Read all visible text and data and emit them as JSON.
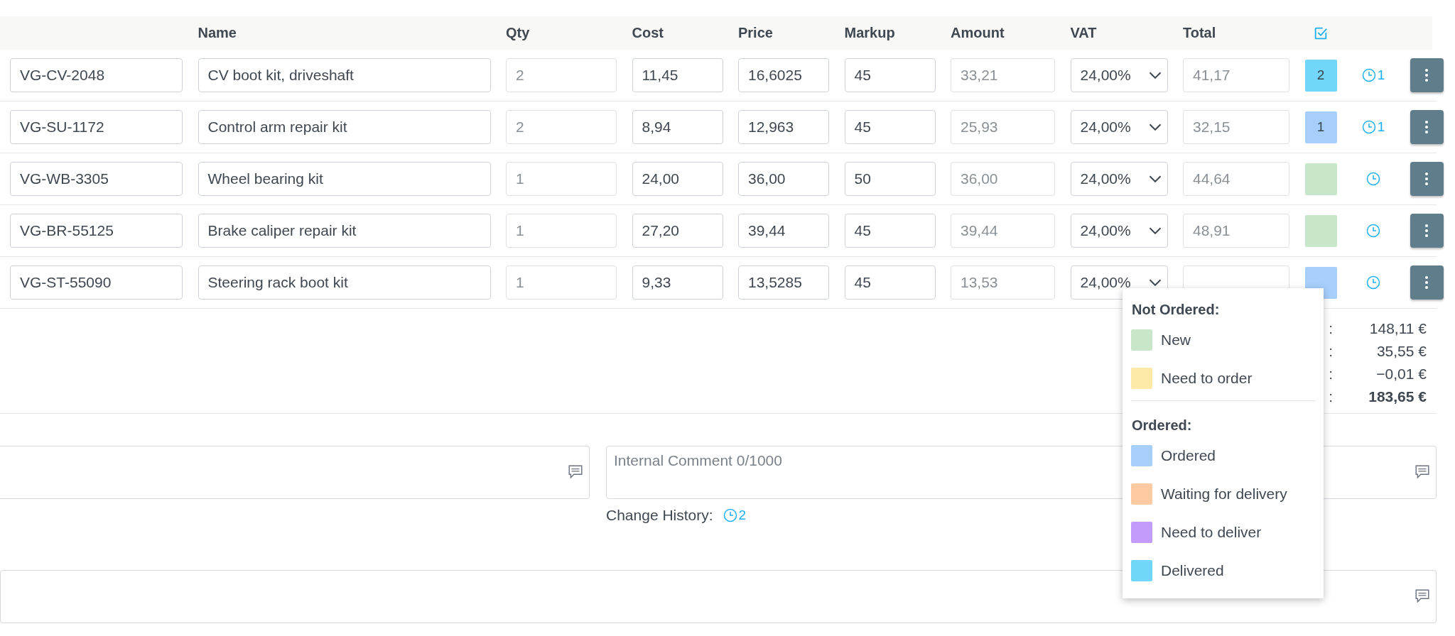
{
  "columns": [
    "Name",
    "Qty",
    "Cost",
    "Price",
    "Markup",
    "Amount",
    "VAT",
    "Total"
  ],
  "rows": [
    {
      "code": "VG-CV-2048",
      "name": "CV boot kit, driveshaft",
      "qty": "2",
      "cost": "11,45",
      "price": "16,6025",
      "markup": "45",
      "amount": "33,21",
      "vat": "24,00%",
      "total": "41,17",
      "status": {
        "color": "#72d6fb",
        "count": "2"
      },
      "history_count": "1"
    },
    {
      "code": "VG-SU-1172",
      "name": "Control arm repair kit",
      "qty": "2",
      "cost": "8,94",
      "price": "12,963",
      "markup": "45",
      "amount": "25,93",
      "vat": "24,00%",
      "total": "32,15",
      "status": {
        "color": "#a6cffc",
        "count": "1"
      },
      "history_count": "1"
    },
    {
      "code": "VG-WB-3305",
      "name": "Wheel bearing kit",
      "qty": "1",
      "cost": "24,00",
      "price": "36,00",
      "markup": "50",
      "amount": "36,00",
      "vat": "24,00%",
      "total": "44,64",
      "status": {
        "color": "#c8e6c9"
      }
    },
    {
      "code": "VG-BR-55125",
      "name": "Brake caliper repair kit",
      "qty": "1",
      "cost": "27,20",
      "price": "39,44",
      "markup": "45",
      "amount": "39,44",
      "vat": "24,00%",
      "total": "48,91",
      "status": {
        "color": "#c8e6c9"
      }
    },
    {
      "code": "VG-ST-55090",
      "name": "Steering rack boot kit",
      "qty": "1",
      "cost": "9,33",
      "price": "13,5285",
      "markup": "45",
      "amount": "13,53",
      "vat": "24,00%",
      "status": {
        "color": "#a6cffc"
      }
    }
  ],
  "totals": [
    {
      "label": ":",
      "value": "148,11 €",
      "bold": false
    },
    {
      "label": ":",
      "value": "35,55 €",
      "bold": false
    },
    {
      "label": ":",
      "value": "−0,01 €",
      "bold": false
    },
    {
      "label": ":",
      "value": "183,65 €",
      "bold": true
    }
  ],
  "internal_comment": {
    "placeholder": "Internal Comment 0/1000"
  },
  "change_history": {
    "label": "Change History:",
    "count": "2"
  },
  "status_menu": {
    "groups": [
      {
        "title": "Not Ordered:",
        "options": [
          {
            "label": "New",
            "color": "#c8e6c9"
          },
          {
            "label": "Need to order",
            "color": "#fdeaa8"
          }
        ]
      },
      {
        "title": "Ordered:",
        "options": [
          {
            "label": "Ordered",
            "color": "#a6cffc"
          },
          {
            "label": "Waiting for delivery",
            "color": "#fdcaa2"
          },
          {
            "label": "Need to deliver",
            "color": "#c39cfb"
          },
          {
            "label": "Delivered",
            "color": "#72d6fb"
          }
        ]
      }
    ]
  }
}
